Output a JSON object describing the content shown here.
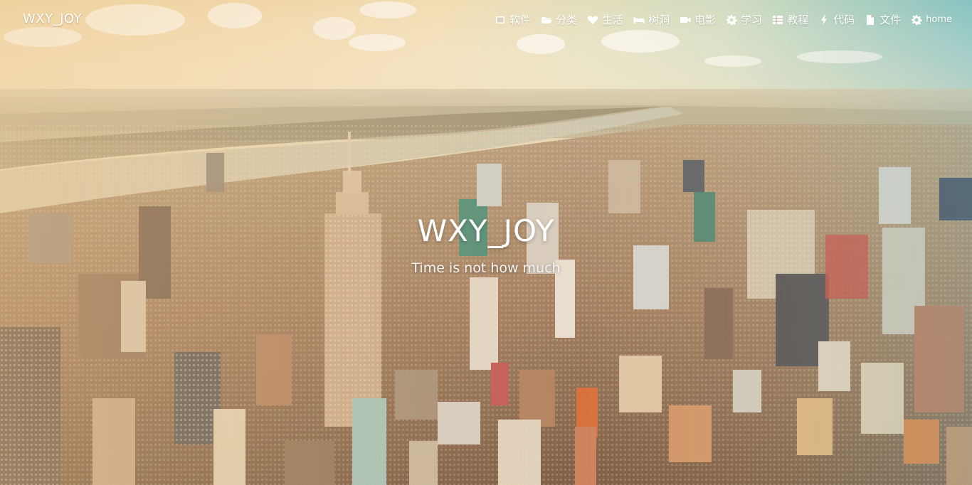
{
  "site": {
    "brand": "WXY_JOY"
  },
  "nav": {
    "items": [
      {
        "label": "软件",
        "icon": "tablet-icon"
      },
      {
        "label": "分类",
        "icon": "folder-open-icon"
      },
      {
        "label": "生活",
        "icon": "heart-icon"
      },
      {
        "label": "树洞",
        "icon": "bed-icon"
      },
      {
        "label": "电影",
        "icon": "video-camera-icon"
      },
      {
        "label": "学习",
        "icon": "gear-icon"
      },
      {
        "label": "教程",
        "icon": "grid-icon"
      },
      {
        "label": "代码",
        "icon": "bolt-icon"
      },
      {
        "label": "文件",
        "icon": "file-icon"
      },
      {
        "label": "home",
        "icon": "gear-icon"
      }
    ]
  },
  "hero": {
    "title": "WXY_JOY",
    "subtitle": "Time is not how much"
  },
  "colors": {
    "text": "#ffffff",
    "sky_warm": "#f3dcae",
    "sky_cool": "#8cc8c6"
  }
}
